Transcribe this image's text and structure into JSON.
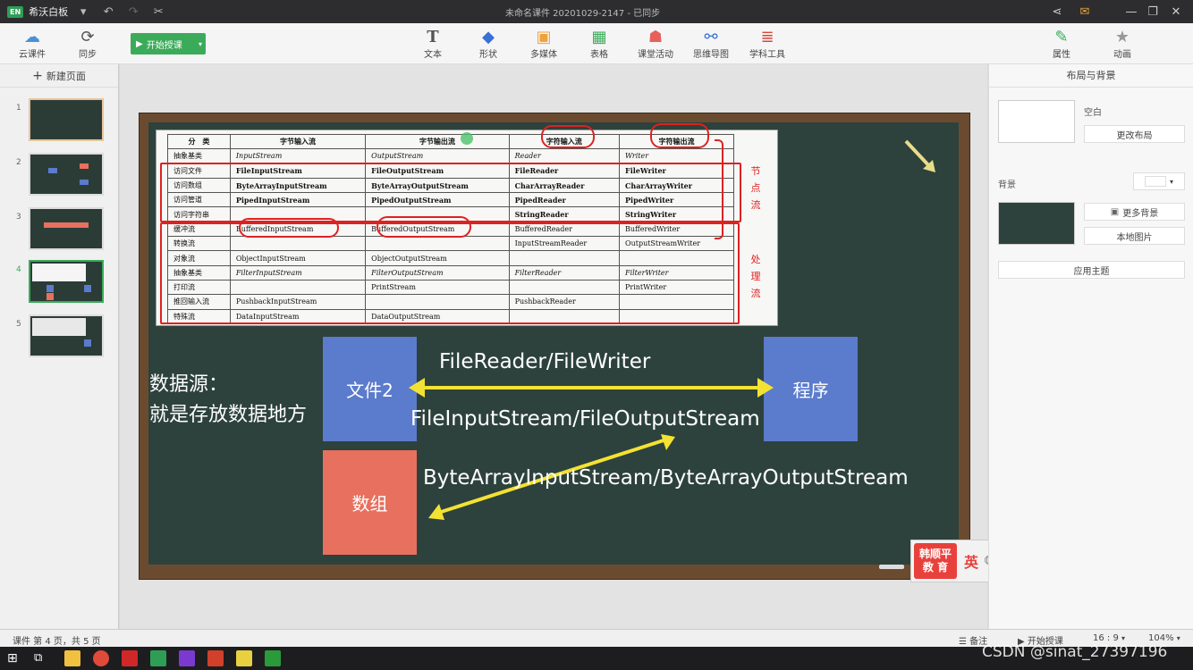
{
  "titlebar": {
    "app_badge": "EN",
    "app_name": "希沃白板",
    "doc_title": "未命名课件 20201029-2147 - 已同步"
  },
  "toolbar": {
    "cloud_label": "云课件",
    "sync_label": "同步",
    "start_label": "开始授课",
    "tools": [
      "文本",
      "形状",
      "多媒体",
      "表格",
      "课堂活动",
      "思维导图",
      "学科工具"
    ],
    "props_label": "属性",
    "anim_label": "动画"
  },
  "sidebar": {
    "new_page_label": "新建页面",
    "pages": [
      "1",
      "2",
      "3",
      "4",
      "5"
    ],
    "active_page": 4
  },
  "slide": {
    "table": {
      "header": [
        "分　类",
        "字节输入流",
        "字节输出流",
        "字符输入流",
        "字符输出流"
      ],
      "rows": [
        [
          "抽象基类",
          "InputStream",
          "OutputStream",
          "Reader",
          "Writer"
        ],
        [
          "访问文件",
          "FileInputStream",
          "FileOutputStream",
          "FileReader",
          "FileWriter"
        ],
        [
          "访问数组",
          "ByteArrayInputStream",
          "ByteArrayOutputStream",
          "CharArrayReader",
          "CharArrayWriter"
        ],
        [
          "访问管道",
          "PipedInputStream",
          "PipedOutputStream",
          "PipedReader",
          "PipedWriter"
        ],
        [
          "访问字符串",
          "",
          "",
          "StringReader",
          "StringWriter"
        ],
        [
          "缓冲流",
          "BufferedInputStream",
          "BufferedOutputStream",
          "BufferedReader",
          "BufferedWriter"
        ],
        [
          "转换流",
          "",
          "",
          "InputStreamReader",
          "OutputStreamWriter"
        ],
        [
          "对象流",
          "ObjectInputStream",
          "ObjectOutputStream",
          "",
          ""
        ],
        [
          "抽象基类",
          "FilterInputStream",
          "FilterOutputStream",
          "FilterReader",
          "FilterWriter"
        ],
        [
          "打印流",
          "",
          "PrintStream",
          "",
          "PrintWriter"
        ],
        [
          "推回输入流",
          "PushbackInputStream",
          "",
          "PushbackReader",
          ""
        ],
        [
          "特殊流",
          "DataInputStream",
          "DataOutputStream",
          "",
          ""
        ]
      ],
      "side_label_top": [
        "节",
        "点",
        "流"
      ],
      "side_label_bottom": [
        "处",
        "理",
        "流"
      ]
    },
    "data_source_line1": "数据源：",
    "data_source_line2": "就是存放数据地方",
    "box_file": "文件2",
    "box_program": "程序",
    "box_array": "数组",
    "label_reader_writer": "FileReader/FileWriter",
    "label_file_stream": "FileInputStream/FileOutputStream",
    "label_bytearray_stream": "ByteArrayInputStream/ByteArrayOutputStream",
    "colors": {
      "box_blue": "#5b7bcc",
      "box_red": "#e8705f",
      "arrow_yellow": "#f4e233",
      "slate": "#2d423c",
      "red_marks": "#dd2222"
    }
  },
  "right_panel": {
    "title": "布局与背景",
    "blank_label": "空白",
    "change_layout": "更改布局",
    "background_label": "背景",
    "more_bg": "更多背景",
    "local_image": "本地图片",
    "apply_theme": "应用主题"
  },
  "ime": {
    "logo_line1": "韩顺平",
    "logo_line2": "教 育",
    "lang": "英"
  },
  "status": {
    "page_info": "课件 第 4 页，共 5 页",
    "notes": "备注",
    "start": "开始授课",
    "ratio": "16 : 9",
    "zoom": "104%"
  },
  "watermark": "CSDN @sinat_27397196"
}
